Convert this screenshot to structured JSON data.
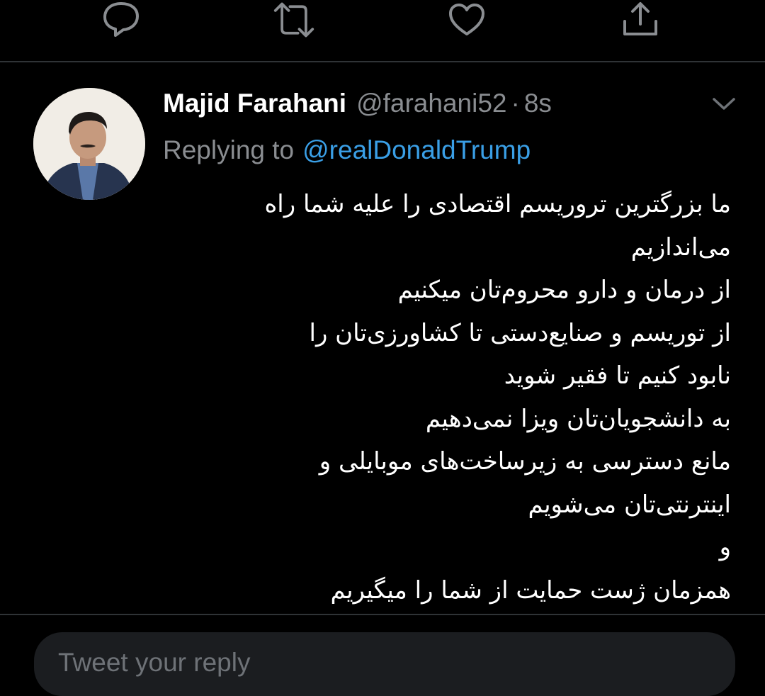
{
  "prev_tweet_actions": {
    "icons": [
      "reply-icon",
      "retweet-icon",
      "like-icon",
      "share-icon"
    ]
  },
  "tweet": {
    "display_name": "Majid Farahani",
    "handle": "@farahani52",
    "separator": "·",
    "time": "8s",
    "replying_label": "Replying to",
    "replying_to": "@realDonaldTrump",
    "text_lines": [
      "ما بزرگترین تروریسم اقتصادی را علیه شما راه",
      "می‌اندازیم",
      "از درمان و دارو محروم‌تان میکنیم",
      "از توریسم و صنایع‌دستی تا کشاورزی‌تان را",
      "نابود کنیم تا فقیر شوید",
      "به دانشجویان‌تان ویزا نمی‌دهیم",
      "مانع دسترسی به زیرساخت‌های موبایلی و",
      "اینترنتی‌تان می‌شویم",
      "و",
      "همزمان ژست حمایت از شما را میگیریم"
    ],
    "caret_icon": "chevron-down-icon"
  },
  "reply_box": {
    "placeholder": "Tweet your reply"
  },
  "colors": {
    "background": "#000000",
    "divider": "#2f3336",
    "muted_text": "#8a8d91",
    "link": "#3a9fe6",
    "icon": "#8a8d91"
  }
}
